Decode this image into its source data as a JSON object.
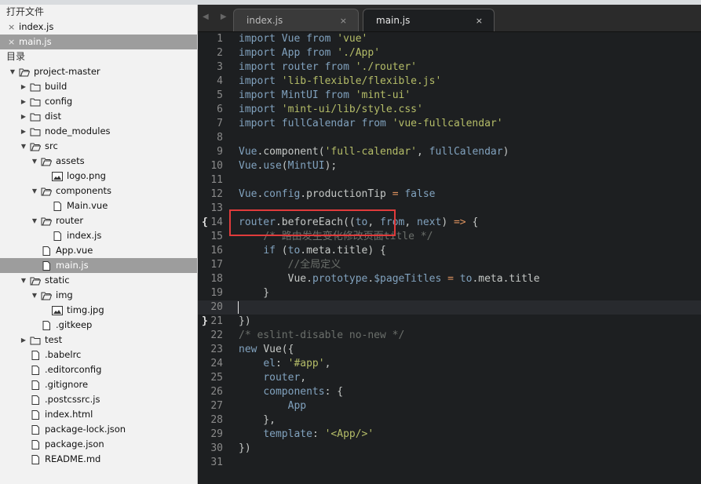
{
  "sidebar": {
    "open_files_title": "打开文件",
    "open_files": [
      {
        "name": "index.js",
        "active": false
      },
      {
        "name": "main.js",
        "active": true
      }
    ],
    "folders_title": "目录",
    "tree": [
      {
        "name": "project-master",
        "type": "folder",
        "open": true,
        "depth": 0
      },
      {
        "name": "build",
        "type": "folder",
        "open": false,
        "depth": 1
      },
      {
        "name": "config",
        "type": "folder",
        "open": false,
        "depth": 1
      },
      {
        "name": "dist",
        "type": "folder",
        "open": false,
        "depth": 1
      },
      {
        "name": "node_modules",
        "type": "folder",
        "open": false,
        "depth": 1
      },
      {
        "name": "src",
        "type": "folder",
        "open": true,
        "depth": 1
      },
      {
        "name": "assets",
        "type": "folder",
        "open": true,
        "depth": 2
      },
      {
        "name": "logo.png",
        "type": "image",
        "depth": 3
      },
      {
        "name": "components",
        "type": "folder",
        "open": true,
        "depth": 2
      },
      {
        "name": "Main.vue",
        "type": "file",
        "depth": 3
      },
      {
        "name": "router",
        "type": "folder",
        "open": true,
        "depth": 2
      },
      {
        "name": "index.js",
        "type": "file",
        "depth": 3
      },
      {
        "name": "App.vue",
        "type": "file",
        "depth": 2
      },
      {
        "name": "main.js",
        "type": "file",
        "depth": 2,
        "selected": true
      },
      {
        "name": "static",
        "type": "folder",
        "open": true,
        "depth": 1
      },
      {
        "name": "img",
        "type": "folder",
        "open": true,
        "depth": 2
      },
      {
        "name": "timg.jpg",
        "type": "image",
        "depth": 3
      },
      {
        "name": ".gitkeep",
        "type": "file",
        "depth": 2
      },
      {
        "name": "test",
        "type": "folder",
        "open": false,
        "depth": 1
      },
      {
        "name": ".babelrc",
        "type": "file",
        "depth": 1
      },
      {
        "name": ".editorconfig",
        "type": "file",
        "depth": 1
      },
      {
        "name": ".gitignore",
        "type": "file",
        "depth": 1
      },
      {
        "name": ".postcssrc.js",
        "type": "file",
        "depth": 1
      },
      {
        "name": "index.html",
        "type": "file",
        "depth": 1
      },
      {
        "name": "package-lock.json",
        "type": "file",
        "depth": 1
      },
      {
        "name": "package.json",
        "type": "file",
        "depth": 1
      },
      {
        "name": "README.md",
        "type": "file",
        "depth": 1
      }
    ]
  },
  "tabs": [
    {
      "label": "index.js",
      "close": "×",
      "active": false
    },
    {
      "label": "main.js",
      "close": "×",
      "active": true
    }
  ],
  "tab_nav": "◀ ▶",
  "editor": {
    "current_line": 20,
    "fold_markers": {
      "14": "{",
      "21": "}"
    },
    "lines": [
      [
        [
          "k",
          "import "
        ],
        [
          "i",
          "Vue "
        ],
        [
          "k",
          "from "
        ],
        [
          "s",
          "'vue'"
        ]
      ],
      [
        [
          "k",
          "import "
        ],
        [
          "i",
          "App "
        ],
        [
          "k",
          "from "
        ],
        [
          "s",
          "'./App'"
        ]
      ],
      [
        [
          "k",
          "import "
        ],
        [
          "i",
          "router "
        ],
        [
          "k",
          "from "
        ],
        [
          "s",
          "'./router'"
        ]
      ],
      [
        [
          "k",
          "import "
        ],
        [
          "s",
          "'lib-flexible/flexible.js'"
        ]
      ],
      [
        [
          "k",
          "import "
        ],
        [
          "i",
          "MintUI "
        ],
        [
          "k",
          "from "
        ],
        [
          "s",
          "'mint-ui'"
        ]
      ],
      [
        [
          "k",
          "import "
        ],
        [
          "s",
          "'mint-ui/lib/style.css'"
        ]
      ],
      [
        [
          "k",
          "import "
        ],
        [
          "i",
          "fullCalendar "
        ],
        [
          "k",
          "from "
        ],
        [
          "s",
          "'vue-fullcalendar'"
        ]
      ],
      [],
      [
        [
          "i",
          "Vue"
        ],
        [
          "v",
          "."
        ],
        [
          "v",
          "component("
        ],
        [
          "s",
          "'full-calendar'"
        ],
        [
          "v",
          ", "
        ],
        [
          "i",
          "fullCalendar"
        ],
        [
          "v",
          ")"
        ]
      ],
      [
        [
          "i",
          "Vue"
        ],
        [
          "v",
          "."
        ],
        [
          "i",
          "use"
        ],
        [
          "v",
          "("
        ],
        [
          "i",
          "MintUI"
        ],
        [
          "v",
          ");"
        ]
      ],
      [],
      [
        [
          "i",
          "Vue"
        ],
        [
          "v",
          "."
        ],
        [
          "i",
          "config"
        ],
        [
          "v",
          "."
        ],
        [
          "v",
          "productionTip "
        ],
        [
          "o",
          "= "
        ],
        [
          "i",
          "false"
        ]
      ],
      [],
      [
        [
          "i",
          "router"
        ],
        [
          "v",
          "."
        ],
        [
          "v",
          "beforeEach"
        ],
        [
          "v",
          "(("
        ],
        [
          "i",
          "to"
        ],
        [
          "v",
          ", "
        ],
        [
          "i",
          "from"
        ],
        [
          "v",
          ", "
        ],
        [
          "i",
          "next"
        ],
        [
          "v",
          ") "
        ],
        [
          "o",
          "=> "
        ],
        [
          "v",
          "{"
        ]
      ],
      [
        [
          "v",
          "    "
        ],
        [
          "c",
          "/* 路由发生变化修改页面title */"
        ]
      ],
      [
        [
          "v",
          "    "
        ],
        [
          "k",
          "if "
        ],
        [
          "v",
          "("
        ],
        [
          "i",
          "to"
        ],
        [
          "v",
          "."
        ],
        [
          "v",
          "meta"
        ],
        [
          "v",
          "."
        ],
        [
          "v",
          "title) {"
        ]
      ],
      [
        [
          "v",
          "        "
        ],
        [
          "c",
          "//全局定义"
        ]
      ],
      [
        [
          "v",
          "        "
        ],
        [
          "v",
          "Vue"
        ],
        [
          "v",
          "."
        ],
        [
          "i",
          "prototype"
        ],
        [
          "v",
          "."
        ],
        [
          "i",
          "$pageTitles "
        ],
        [
          "o",
          "= "
        ],
        [
          "i",
          "to"
        ],
        [
          "v",
          "."
        ],
        [
          "v",
          "meta"
        ],
        [
          "v",
          "."
        ],
        [
          "v",
          "title"
        ]
      ],
      [
        [
          "v",
          "    }"
        ]
      ],
      [],
      [
        [
          "v",
          "})"
        ]
      ],
      [
        [
          "c",
          "/* eslint-disable no-new */"
        ]
      ],
      [
        [
          "k",
          "new "
        ],
        [
          "v",
          "Vue({"
        ]
      ],
      [
        [
          "v",
          "    "
        ],
        [
          "i",
          "el"
        ],
        [
          "v",
          ": "
        ],
        [
          "s",
          "'#app'"
        ],
        [
          "v",
          ","
        ]
      ],
      [
        [
          "v",
          "    "
        ],
        [
          "i",
          "router"
        ],
        [
          "v",
          ","
        ]
      ],
      [
        [
          "v",
          "    "
        ],
        [
          "i",
          "components"
        ],
        [
          "v",
          ": {"
        ]
      ],
      [
        [
          "v",
          "        "
        ],
        [
          "i",
          "App"
        ]
      ],
      [
        [
          "v",
          "    },"
        ]
      ],
      [
        [
          "v",
          "    "
        ],
        [
          "i",
          "template"
        ],
        [
          "v",
          ": "
        ],
        [
          "s",
          "'<App/>'"
        ]
      ],
      [
        [
          "v",
          "})"
        ]
      ],
      []
    ]
  },
  "colors": {
    "editor_bg": "#1d1f21",
    "highlight_box": "#e03b3b",
    "keyword": "#81a2be",
    "string": "#b5bd68",
    "comment": "#6b6f6b",
    "operator": "#de935f"
  }
}
